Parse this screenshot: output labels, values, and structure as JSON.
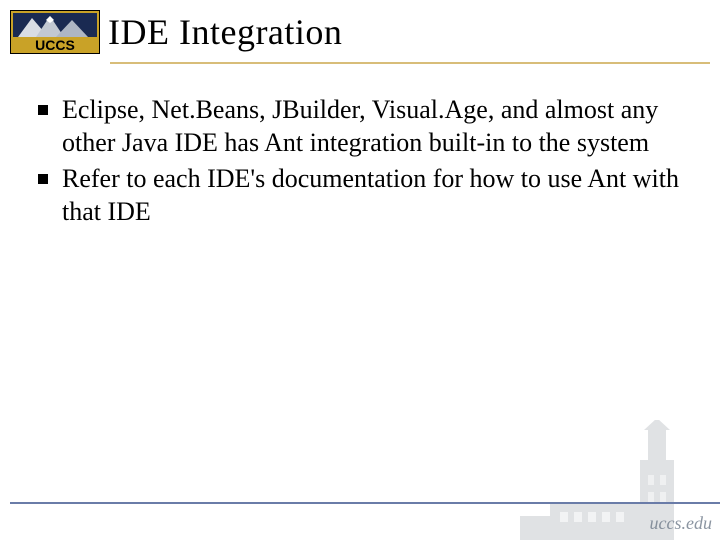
{
  "header": {
    "logo_text": "UCCS",
    "title": "IDE Integration"
  },
  "bullets": [
    {
      "text": "Eclipse, Net.Beans, JBuilder, Visual.Age, and almost any other Java IDE has Ant integration built-in to the system"
    },
    {
      "text": "Refer to each IDE's documentation for how to use Ant with that IDE"
    }
  ],
  "footer": {
    "url": "uccs.edu"
  },
  "colors": {
    "gold": "#c9a227",
    "navy": "#1a2a52",
    "rule": "#6a7ca8"
  }
}
